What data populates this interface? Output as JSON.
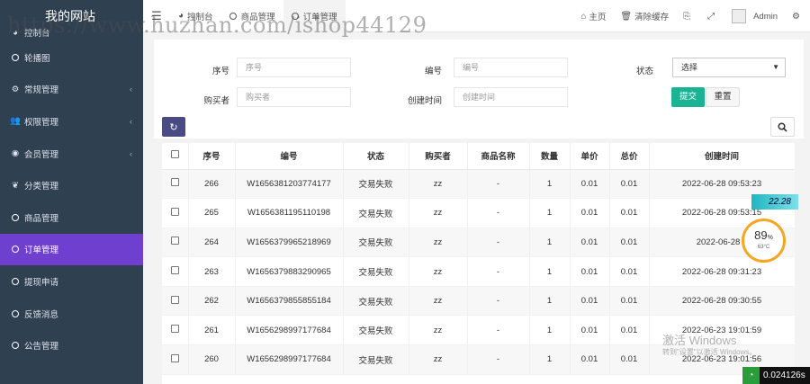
{
  "sidebar": {
    "brand": "我的网站",
    "items": [
      {
        "label": "控制台",
        "icon": "dashboard-icon",
        "has_children": false
      },
      {
        "label": "轮播图",
        "icon": "circle-icon",
        "has_children": false
      },
      {
        "label": "常规管理",
        "icon": "cogs-icon",
        "has_children": true
      },
      {
        "label": "权限管理",
        "icon": "users-icon",
        "has_children": true
      },
      {
        "label": "会员管理",
        "icon": "user-circle-icon",
        "has_children": true
      },
      {
        "label": "分类管理",
        "icon": "leaf-icon",
        "has_children": false
      },
      {
        "label": "商品管理",
        "icon": "circle-icon",
        "has_children": false
      },
      {
        "label": "订单管理",
        "icon": "circle-icon",
        "has_children": false,
        "active": true
      },
      {
        "label": "提现申请",
        "icon": "circle-icon",
        "has_children": false
      },
      {
        "label": "反馈消息",
        "icon": "circle-icon",
        "has_children": false
      },
      {
        "label": "公告管理",
        "icon": "circle-icon",
        "has_children": false
      }
    ]
  },
  "header": {
    "tabs": [
      {
        "label": "控制台",
        "icon": "dashboard-icon"
      },
      {
        "label": "商品管理",
        "icon": "circle-icon"
      },
      {
        "label": "订单管理",
        "icon": "circle-icon",
        "active": true
      }
    ],
    "right": {
      "home": "主页",
      "clear_cache": "清除缓存",
      "user": "Admin"
    }
  },
  "watermark": "https://www.huzhan.com/ishop44129",
  "search": {
    "seq_label": "序号",
    "seq_placeholder": "序号",
    "no_label": "编号",
    "no_placeholder": "编号",
    "status_label": "状态",
    "status_value": "选择",
    "buyer_label": "购买者",
    "buyer_placeholder": "购买者",
    "created_label": "创建时间",
    "created_placeholder": "创建时间",
    "submit": "提交",
    "reset": "重置"
  },
  "table": {
    "columns": [
      "序号",
      "编号",
      "状态",
      "购买者",
      "商品名称",
      "数量",
      "单价",
      "总价",
      "创建时间"
    ],
    "rows": [
      [
        "266",
        "W1656381203774177",
        "交易失败",
        "zz",
        "-",
        "1",
        "0.01",
        "0.01",
        "2022-06-28 09:53:23"
      ],
      [
        "265",
        "W1656381195110198",
        "交易失败",
        "zz",
        "-",
        "1",
        "0.01",
        "0.01",
        "2022-06-28 09:53:15"
      ],
      [
        "264",
        "W1656379965218969",
        "交易失败",
        "zz",
        "-",
        "1",
        "0.01",
        "0.01",
        "2022-06-28 0"
      ],
      [
        "263",
        "W1656379883290965",
        "交易失败",
        "zz",
        "-",
        "1",
        "0.01",
        "0.01",
        "2022-06-28 09:31:23"
      ],
      [
        "262",
        "W1656379855855184",
        "交易失败",
        "zz",
        "-",
        "1",
        "0.01",
        "0.01",
        "2022-06-28 09:30:55"
      ],
      [
        "261",
        "W1656298997177684",
        "交易失败",
        "zz",
        "-",
        "1",
        "0.01",
        "0.01",
        "2022-06-23 19:01:59"
      ],
      [
        "260",
        "W1656298997177684",
        "交易失败",
        "zz",
        "-",
        "1",
        "0.01",
        "0.01",
        "2022-06-23 19:01:56"
      ]
    ]
  },
  "overlay": {
    "speed": "22.28",
    "cpu_percent": "89",
    "cpu_unit": "%",
    "temperature": "63°C",
    "activate_title": "激活 Windows",
    "activate_sub": "转到\"设置\"以激活 Windows。",
    "timer": "0.024126s"
  }
}
